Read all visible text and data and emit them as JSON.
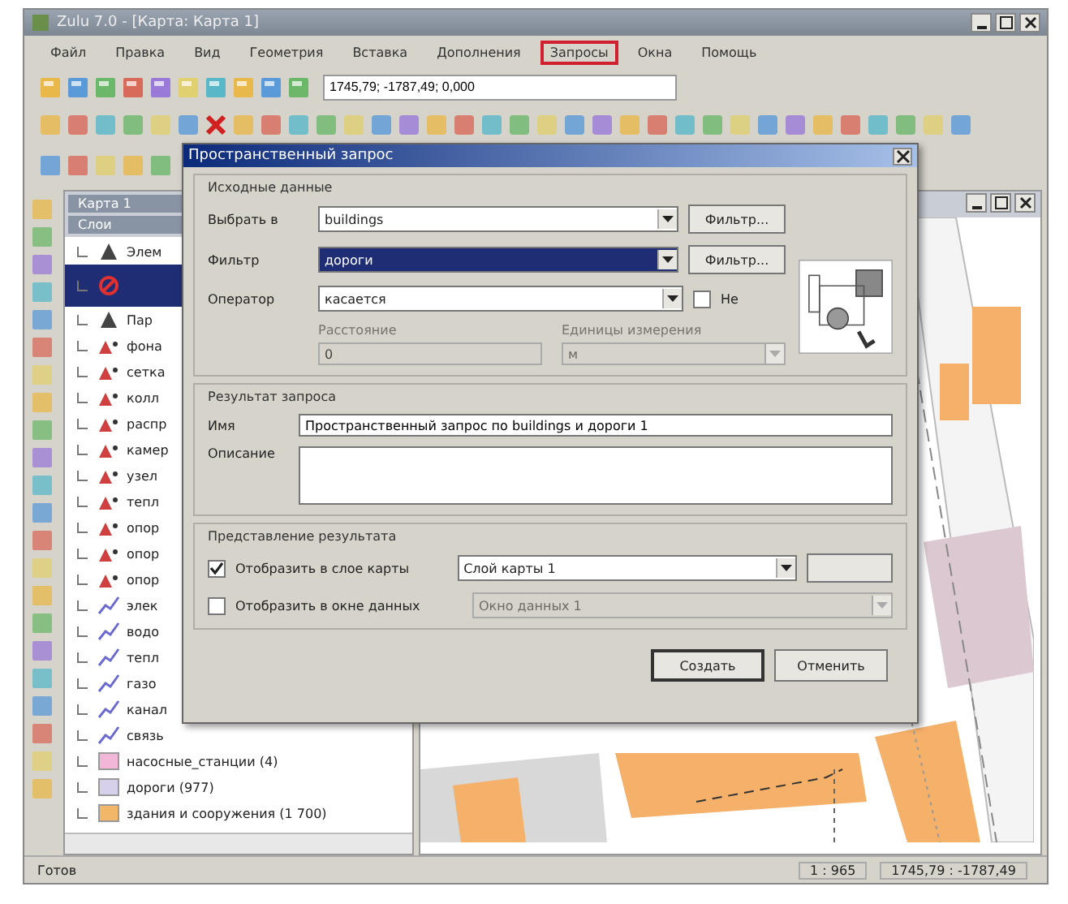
{
  "window": {
    "title": "Zulu 7.0 - [Карта: Карта 1]"
  },
  "menu": [
    {
      "label": "Файл",
      "selected": false
    },
    {
      "label": "Правка",
      "selected": false
    },
    {
      "label": "Вид",
      "selected": false
    },
    {
      "label": "Геометрия",
      "selected": false
    },
    {
      "label": "Вставка",
      "selected": false
    },
    {
      "label": "Дополнения",
      "selected": false
    },
    {
      "label": "Запросы",
      "selected": true
    },
    {
      "label": "Окна",
      "selected": false
    },
    {
      "label": "Помощь",
      "selected": false
    }
  ],
  "coordinates": {
    "value": "1745,79; -1787,49; 0,000"
  },
  "layers_panel": {
    "title": "Карта 1",
    "subtitle": "Слои",
    "items": [
      {
        "label": "Элем",
        "kind": "group",
        "selected": false
      },
      {
        "kind": "blocked",
        "selected": true
      },
      {
        "label": "Пар",
        "kind": "group",
        "selected": false
      },
      {
        "label": "фона",
        "kind": "point",
        "selected": false
      },
      {
        "label": "сетка",
        "kind": "point",
        "selected": false
      },
      {
        "label": "колл",
        "kind": "point",
        "selected": false
      },
      {
        "label": "распр",
        "kind": "point",
        "selected": false
      },
      {
        "label": "камер",
        "kind": "point",
        "selected": false
      },
      {
        "label": "узел",
        "kind": "point",
        "selected": false
      },
      {
        "label": "тепл",
        "kind": "point",
        "selected": false
      },
      {
        "label": "опор",
        "kind": "point",
        "selected": false
      },
      {
        "label": "опор",
        "kind": "point",
        "selected": false
      },
      {
        "label": "опор",
        "kind": "point",
        "selected": false
      },
      {
        "label": "элек",
        "kind": "line",
        "selected": false
      },
      {
        "label": "водо",
        "kind": "line",
        "selected": false
      },
      {
        "label": "тепл",
        "kind": "line",
        "selected": false
      },
      {
        "label": "газо",
        "kind": "line",
        "selected": false
      },
      {
        "label": "канал",
        "kind": "line",
        "selected": false
      },
      {
        "label": "связь",
        "kind": "line",
        "selected": false
      },
      {
        "label": "насосные_станции (4)",
        "kind": "polygon",
        "color": "#f2b6d8",
        "selected": false
      },
      {
        "label": "дороги (977)",
        "kind": "polygon",
        "color": "#d7d0ea",
        "selected": false
      },
      {
        "label": "здания и сооружения (1 700)",
        "kind": "polygon",
        "color": "#f3b76a",
        "selected": false
      }
    ]
  },
  "dialog": {
    "title": "Пространственный запрос",
    "source": {
      "title": "Исходные данные",
      "select_in": {
        "label": "Выбрать в",
        "value": "buildings",
        "button": "Фильтр..."
      },
      "filter": {
        "label": "Фильтр",
        "value": "дороги",
        "button": "Фильтр..."
      },
      "operator": {
        "label": "Оператор",
        "value": "касается",
        "negate": {
          "label": "Не",
          "checked": false
        }
      },
      "distance": {
        "label": "Расстояние",
        "value": "0",
        "disabled": true
      },
      "units": {
        "label": "Единицы измерения",
        "value": "м",
        "disabled": true
      }
    },
    "result": {
      "title": "Результат запроса",
      "name": {
        "label": "Имя",
        "value": "Пространственный запрос по buildings и дороги 1"
      },
      "description": {
        "label": "Описание"
      }
    },
    "presentation": {
      "title": "Представление результата",
      "options": [
        {
          "label": "Отобразить в слое карты",
          "checked": true,
          "value": "Слой карты 1"
        },
        {
          "label": "Отобразить в окне данных",
          "checked": false,
          "value": "Окно данных 1"
        }
      ]
    },
    "buttons": [
      "Создать",
      "Отменить"
    ]
  },
  "status_bar": {
    "text": "Готов",
    "scale": "1 : 965",
    "position": "1745,79 : -1787,49"
  }
}
